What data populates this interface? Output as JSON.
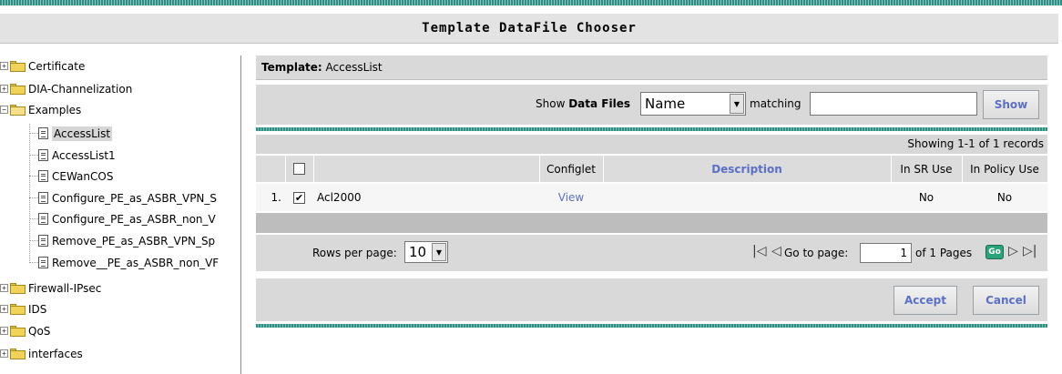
{
  "window": {
    "title": "Template DataFile Chooser"
  },
  "tree": {
    "items": [
      {
        "label": "Certificate",
        "type": "folder",
        "expander": "+"
      },
      {
        "label": "DIA-Channelization",
        "type": "folder",
        "expander": "+"
      },
      {
        "label": "Examples",
        "type": "folder-open",
        "expander": "−"
      },
      {
        "label": "AccessList",
        "type": "file",
        "selected": true
      },
      {
        "label": "AccessList1",
        "type": "file"
      },
      {
        "label": "CEWanCOS",
        "type": "file"
      },
      {
        "label": "Configure_PE_as_ASBR_VPN_S",
        "type": "file"
      },
      {
        "label": "Configure_PE_as_ASBR_non_V",
        "type": "file"
      },
      {
        "label": "Remove_PE_as_ASBR_VPN_Sp",
        "type": "file"
      },
      {
        "label": "Remove__PE_as_ASBR_non_VF",
        "type": "file"
      },
      {
        "label": "Firewall-IPsec",
        "type": "folder",
        "expander": "+"
      },
      {
        "label": "IDS",
        "type": "folder",
        "expander": "+"
      },
      {
        "label": "QoS",
        "type": "folder",
        "expander": "+"
      },
      {
        "label": "interfaces",
        "type": "folder",
        "expander": "+"
      }
    ]
  },
  "template": {
    "label": "Template:",
    "value": "AccessList"
  },
  "filter": {
    "show_label": "Show",
    "data_files_label": "Data Files",
    "field_selected": "Name",
    "matching_label": "matching",
    "matching_value": "",
    "show_button": "Show"
  },
  "table": {
    "showing": "Showing 1-1 of 1 records",
    "headers": {
      "configlet": "Configlet",
      "description": "Description",
      "in_sr_use": "In SR Use",
      "in_policy_use": "In Policy Use"
    },
    "rows": [
      {
        "index": "1.",
        "checked": true,
        "name": "Acl2000",
        "configlet": "View",
        "description": "",
        "in_sr_use": "No",
        "in_policy_use": "No"
      }
    ]
  },
  "pager": {
    "rows_per_page_label": "Rows per page:",
    "rows_per_page": "10",
    "go_to_label": "Go to page:",
    "page": "1",
    "of_pages": "of 1 Pages",
    "go_label": "Go"
  },
  "actions": {
    "accept": "Accept",
    "cancel": "Cancel"
  },
  "icons": [
    "expand-icon",
    "collapse-icon",
    "folder-icon",
    "folder-open-icon",
    "document-icon",
    "dropdown-arrow-icon",
    "first-page-icon",
    "prev-page-icon",
    "go-icon",
    "next-page-icon",
    "last-page-icon"
  ],
  "colors": {
    "accent_link": "#5b6fc7",
    "teal_stripe": "#2f8f85",
    "panel_gray": "#d9d9d9",
    "go_green": "#2aa37a"
  }
}
